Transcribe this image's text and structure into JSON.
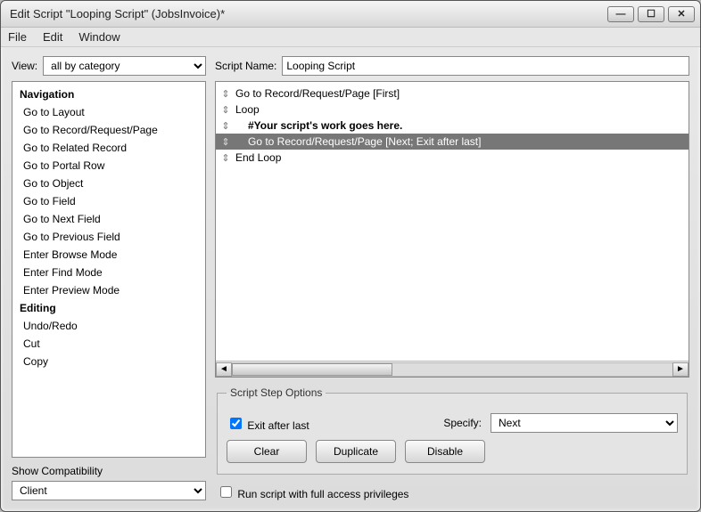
{
  "window": {
    "title": "Edit Script \"Looping Script\" (JobsInvoice)*"
  },
  "menu": {
    "file": "File",
    "edit": "Edit",
    "window": "Window"
  },
  "left": {
    "view_label": "View:",
    "view_value": "all by category",
    "categories": [
      {
        "name": "Navigation",
        "items": [
          "Go to Layout",
          "Go to Record/Request/Page",
          "Go to Related Record",
          "Go to Portal Row",
          "Go to Object",
          "Go to Field",
          "Go to Next Field",
          "Go to Previous Field",
          "Enter Browse Mode",
          "Enter Find Mode",
          "Enter Preview Mode"
        ]
      },
      {
        "name": "Editing",
        "items": [
          "Undo/Redo",
          "Cut",
          "Copy"
        ]
      }
    ],
    "compat_label": "Show Compatibility",
    "compat_value": "Client"
  },
  "right": {
    "scriptname_label": "Script Name:",
    "scriptname_value": "Looping Script",
    "steps": [
      {
        "text": "Go to Record/Request/Page [First]",
        "indent": 0,
        "selected": false
      },
      {
        "text": "Loop",
        "indent": 0,
        "selected": false
      },
      {
        "text": "#Your script's work goes here.",
        "indent": 1,
        "selected": false,
        "bold": true
      },
      {
        "text": "Go to Record/Request/Page [Next; Exit after last]",
        "indent": 1,
        "selected": true
      },
      {
        "text": "End Loop",
        "indent": 0,
        "selected": false
      }
    ],
    "options_legend": "Script Step Options",
    "exit_after_last_label": "Exit after last",
    "exit_after_last_checked": true,
    "specify_label": "Specify:",
    "specify_value": "Next",
    "buttons": {
      "clear": "Clear",
      "duplicate": "Duplicate",
      "disable": "Disable"
    },
    "run_full_access_label": "Run script with full access privileges",
    "run_full_access_checked": false
  }
}
